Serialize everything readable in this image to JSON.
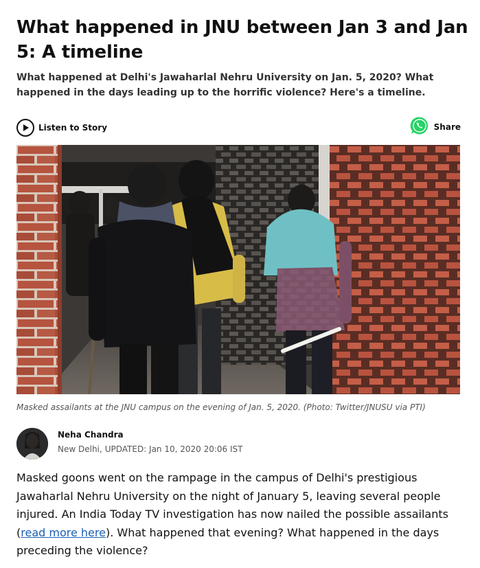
{
  "article": {
    "headline": "What happened in JNU between Jan 3 and Jan 5: A timeline",
    "summary": "What happened at Delhi's Jawaharlal Nehru University on Jan. 5, 2020? What happened in the days leading up to the horrific violence? Here's a timeline.",
    "listen_label": "Listen to Story",
    "share_label": "Share",
    "image_caption": "Masked assailants at the JNU campus on the evening of Jan. 5, 2020. (Photo: Twitter/JNUSU via PTI)",
    "author": {
      "name": "Neha Chandra",
      "location": "New Delhi,",
      "updated": "UPDATED: Jan 10, 2020 20:06 IST"
    },
    "body": {
      "part1": "Masked goons went on the rampage in the campus of Delhi's prestigious Jawaharlal Nehru University on the night of January 5, leaving several people injured. An India Today TV investigation has now nailed the possible assailants (",
      "link": "read more here",
      "part2": "). What happened that evening? What happened in the days preceding the violence?"
    }
  },
  "colors": {
    "brick": "#b5543f",
    "whatsapp": "#25d366",
    "link": "#1a5fb4"
  },
  "icons": {
    "listen": "play-circle-icon",
    "share": "whatsapp-icon"
  }
}
